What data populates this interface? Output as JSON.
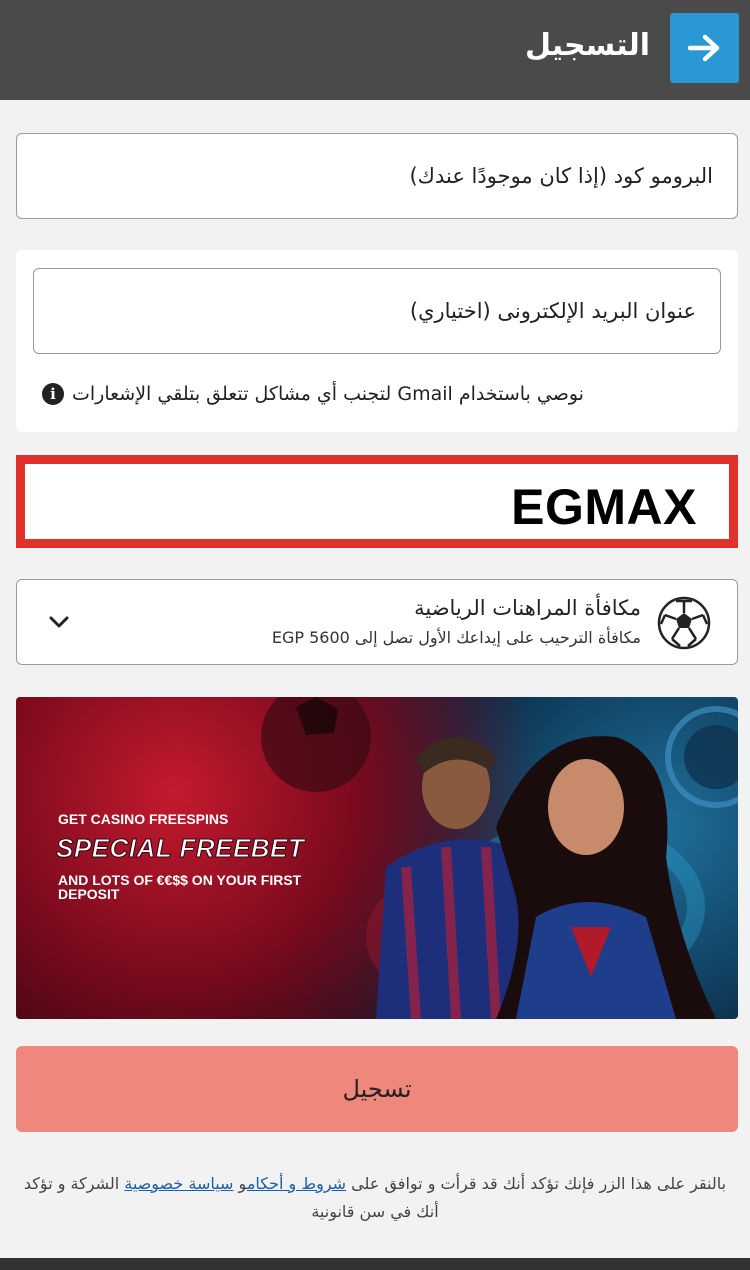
{
  "header": {
    "title": "التسجيل",
    "back_icon": "arrow-right-icon"
  },
  "promo_field": {
    "value": "البرومو كود (إذا كان موجودًا عندك)"
  },
  "email_field": {
    "value": "عنوان البريد الإلكترونى (اختياري)",
    "hint": "نوصي باستخدام Gmail لتجنب أي مشاكل تتعلق بتلقي الإشعارات"
  },
  "promo_code": {
    "value": "EGMAX",
    "highlight_color": "#e0312d"
  },
  "bonus": {
    "title": "مكافأة المراهنات الرياضية",
    "subtitle": "مكافأة الترحيب على إيداعك الأول تصل إلى EGP 5600",
    "icon": "soccer-ball-icon"
  },
  "banner": {
    "line1": "GET CASINO FREESPINS",
    "line2": "SPECIAL FREEBET",
    "line3": "AND LOTS OF €€$$ ON YOUR FIRST DEPOSIT"
  },
  "register_button": {
    "label": "تسجيل",
    "color": "#f0877d"
  },
  "legal": {
    "prefix": "بالنقر على هذا الزر فإنك تؤكد أنك قد قرأت و توافق على ",
    "terms_link": "شروط و أحكام",
    "and": "و ",
    "privacy_link": "سياسة خصوصية",
    "suffix": " الشركة و تؤكد أنك في سن قانونية"
  }
}
